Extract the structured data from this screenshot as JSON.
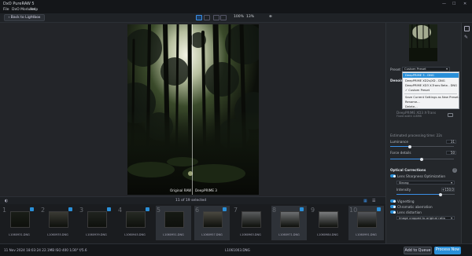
{
  "app": {
    "title": "DxO PureRAW 5"
  },
  "menu": {
    "items": [
      "File",
      "DxO Modules",
      "Help"
    ]
  },
  "toolbar": {
    "back_label": "Back to Lightbox",
    "zoom_fit": "100%",
    "zoom_level": "13%"
  },
  "preview": {
    "left_label": "Original RAW",
    "right_label": "DeepPRIME 3"
  },
  "filmbar": {
    "count_label": "11 of 19 selected"
  },
  "filmstrip": {
    "thumbs": [
      {
        "num": "1",
        "file": "L1060931.DNG",
        "badge": true,
        "selected": false,
        "tone": "#1a1e18"
      },
      {
        "num": "2",
        "file": "L1060935.DNG",
        "badge": true,
        "selected": false,
        "tone": "#3a3a34"
      },
      {
        "num": "3",
        "file": "L1060939.DNG",
        "badge": true,
        "selected": false,
        "tone": "#202420"
      },
      {
        "num": "4",
        "file": "L1060945.DNG",
        "badge": true,
        "selected": false,
        "tone": "#262a24"
      },
      {
        "num": "5",
        "file": "L1060951.DNG",
        "badge": false,
        "selected": true,
        "tone": "#161a14"
      },
      {
        "num": "6",
        "file": "L1060957.DNG",
        "badge": true,
        "selected": true,
        "tone": "#4a4840"
      },
      {
        "num": "7",
        "file": "L1060963.DNG",
        "badge": false,
        "selected": false,
        "tone": "#5a5c5e"
      },
      {
        "num": "8",
        "file": "L1060971.DNG",
        "badge": true,
        "selected": true,
        "tone": "#6e7072"
      },
      {
        "num": "9",
        "file": "L1060984.DNG",
        "badge": false,
        "selected": false,
        "tone": "#7a7c7e"
      },
      {
        "num": "10",
        "file": "L1060991.DNG",
        "badge": true,
        "selected": true,
        "tone": "#54565a"
      },
      {
        "num": "11",
        "file": "L1061003.DNG",
        "badge": false,
        "selected": false,
        "tone": "#8a8c8e"
      }
    ]
  },
  "status": {
    "meta": "11 Nov 2024 18:03:24    22.1MB  ISO 400   1/30\"   f/5.6",
    "filename": "L1061003.DNG",
    "queue_label": "Add to Queue",
    "process_label": "Process Now"
  },
  "panel": {
    "preset_label": "Preset",
    "preset_value": "Custom Preset",
    "denoise_label": "Denoise",
    "denoise_mode": "DeepPRIME XD3 X-Trans",
    "denoise_note": "Fixed width 4.8MB",
    "est_time": "Estimated processing time: 22s",
    "luminance_label": "Luminance",
    "luminance_value": "31",
    "force_label": "Force details",
    "force_value": "50",
    "optical_label": "Optical Corrections",
    "lens_sharp_label": "Lens Sharpness Optimization",
    "sharp_preset": "Strong",
    "intensity_label": "Intensity",
    "intensity_value": "+150.0",
    "vignetting_label": "Vignetting",
    "chromatic_label": "Chromatic aberration",
    "distortion_label": "Lens distortion",
    "distortion_select": "Image cropped to original ratio"
  },
  "dropdown": {
    "items": [
      "DeepPRIME 3 - DNG",
      "DeepPRIME XD2s/XD - DNG",
      "DeepPRIME XD3 X-Trans Beta - DNG",
      "Custom Preset",
      "Save Current Settings as New Preset...",
      "Rename...",
      "Delete..."
    ]
  },
  "colors": {
    "accent": "#2a8fd8",
    "process_button": "#2a8fd8"
  },
  "icons": [
    "minimize-icon",
    "maximize-icon",
    "close-icon",
    "back-arrow-icon",
    "single-view-icon",
    "side-by-side-icon",
    "split-view-icon",
    "loupe-icon",
    "grid-view-icon",
    "list-view-icon",
    "info-icon",
    "contrast-icon",
    "brush-icon"
  ]
}
